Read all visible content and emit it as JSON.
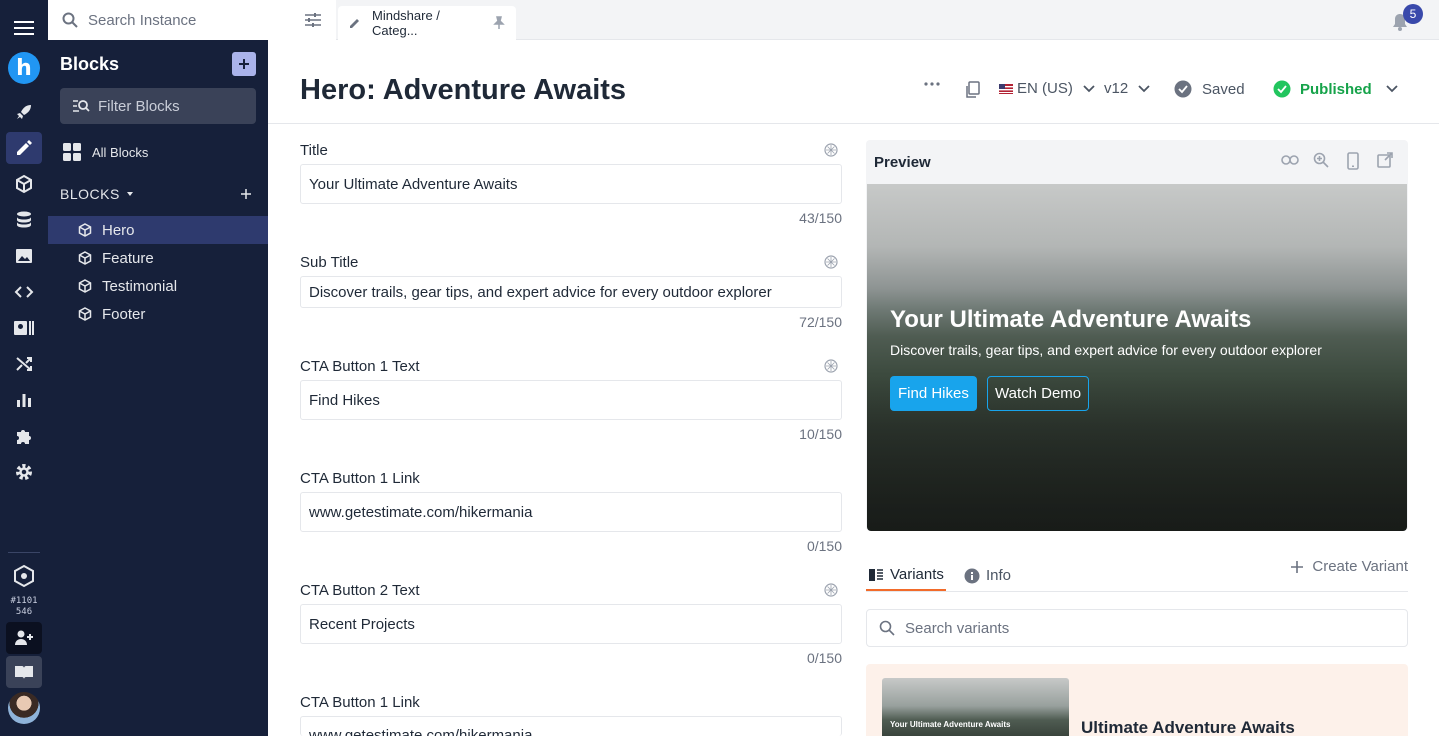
{
  "topbar": {
    "search_placeholder": "Search Instance",
    "tab_label": "Mindshare / Categ...",
    "notifications_count": "5"
  },
  "rail": {
    "org_id": "#1101\n546"
  },
  "sidebar": {
    "title": "Blocks",
    "filter_placeholder": "Filter Blocks",
    "all_blocks_label": "All Blocks",
    "section_label": "BLOCKS",
    "items": [
      {
        "label": "Hero"
      },
      {
        "label": "Feature"
      },
      {
        "label": "Testimonial"
      },
      {
        "label": "Footer"
      }
    ]
  },
  "header": {
    "title": "Hero: Adventure Awaits",
    "locale": "EN (US)",
    "version": "v12",
    "saved_label": "Saved",
    "published_label": "Published"
  },
  "form": {
    "fields": [
      {
        "label": "Title",
        "value": "Your Ultimate Adventure Awaits",
        "count": "43/150"
      },
      {
        "label": "Sub Title",
        "value": "Discover trails, gear tips, and expert advice for every outdoor explorer",
        "count": "72/150"
      },
      {
        "label": "CTA Button 1 Text",
        "value": "Find Hikes",
        "count": "10/150"
      },
      {
        "label": "CTA Button 1 Link",
        "value": "www.getestimate.com/hikermania",
        "count": "0/150"
      },
      {
        "label": "CTA Button 2 Text",
        "value": "Recent Projects",
        "count": "0/150"
      },
      {
        "label": "CTA Button 1 Link",
        "value": "www.getestimate.com/hikermania",
        "count": ""
      }
    ]
  },
  "preview": {
    "title": "Preview",
    "hero_title": "Your Ultimate Adventure Awaits",
    "hero_subtitle": "Discover trails, gear tips, and expert advice for every outdoor explorer",
    "button1": "Find Hikes",
    "button2": "Watch Demo"
  },
  "variants": {
    "tab_variants": "Variants",
    "tab_info": "Info",
    "create_label": "Create Variant",
    "search_placeholder": "Search variants",
    "card_thumb_title": "Your Ultimate Adventure Awaits",
    "card_title": "Ultimate Adventure Awaits"
  },
  "colors": {
    "sidebar_bg": "#16203a",
    "active_item": "#2e3a6e",
    "accent_blue": "#18a4ec",
    "published_green": "#22c55e",
    "tab_underline": "#f26b2a",
    "badge": "#3949ab"
  }
}
